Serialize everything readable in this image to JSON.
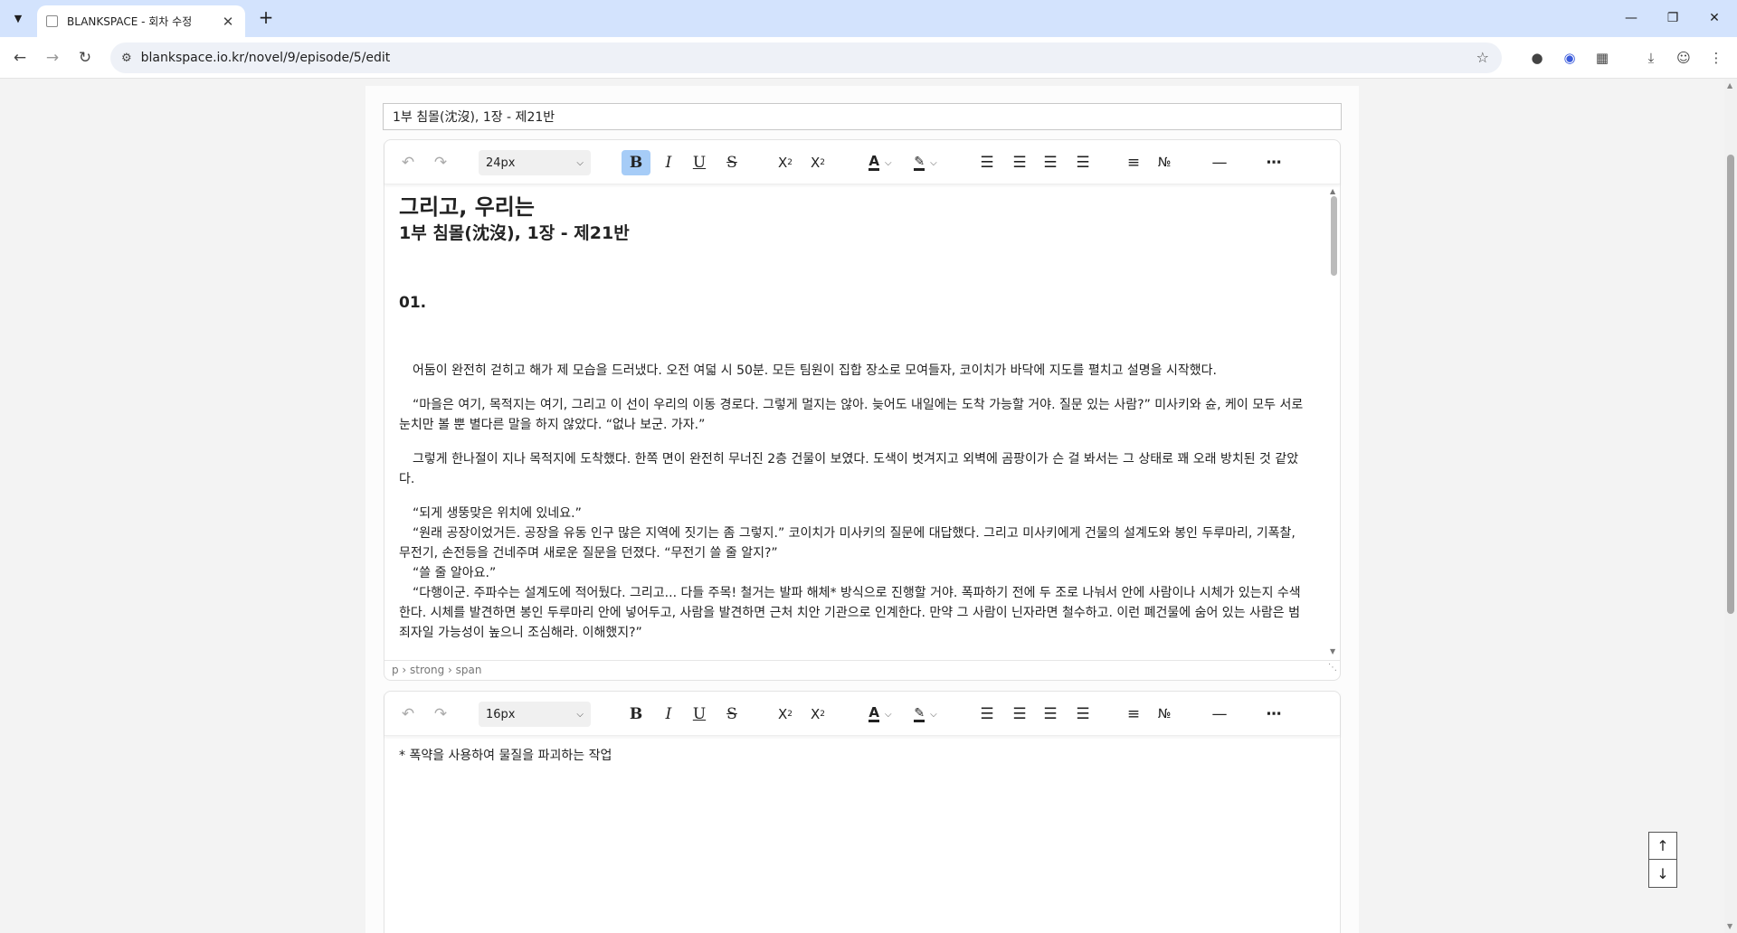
{
  "browser": {
    "tab_title": "BLANKSPACE - 회차 수정",
    "url": "blankspace.io.kr/novel/9/episode/5/edit"
  },
  "form": {
    "title_value": "1부 침몰(沈沒), 1장 - 제21반"
  },
  "main_editor": {
    "font_size": "24px",
    "heading_title": "그리고, 우리는",
    "heading_sub": "1부 침몰(沈沒), 1장 - 제21반",
    "section_number": "01.",
    "paragraphs": [
      "어둠이 완전히 걷히고 해가 제 모습을 드러냈다. 오전 여덟 시 50분. 모든 팀원이 집합 장소로 모여들자, 코이치가 바닥에 지도를 펼치고 설명을 시작했다.",
      "“마을은 여기, 목적지는 여기, 그리고 이 선이 우리의 이동 경로다. 그렇게 멀지는 않아. 늦어도 내일에는 도착 가능할 거야. 질문 있는 사람?” 미사키와 슌, 케이 모두 서로 눈치만 볼 뿐 별다른 말을 하지 않았다. “없나 보군. 가자.”",
      "그렇게 한나절이 지나 목적지에 도착했다. 한쪽 면이 완전히 무너진 2층 건물이 보였다. 도색이 벗겨지고 외벽에 곰팡이가 슨 걸 봐서는 그 상태로 꽤 오래 방치된 것 같았다.",
      "“되게 생뚱맞은 위치에 있네요.”",
      "“원래 공장이었거든. 공장을 유동 인구 많은 지역에 짓기는 좀 그렇지.” 코이치가 미사키의 질문에 대답했다. 그리고 미사키에게 건물의 설계도와 봉인 두루마리, 기폭찰, 무전기, 손전등을 건네주며 새로운 질문을 던졌다. “무전기 쓸 줄 알지?”",
      "“쓸 줄 알아요.”",
      "“다행이군. 주파수는 설계도에 적어뒀다. 그리고... 다들 주목! 철거는 발파 해체* 방식으로 진행할 거야. 폭파하기 전에 두 조로 나눠서 안에 사람이나 시체가 있는지 수색한다. 시체를 발견하면 봉인 두루마리 안에 넣어두고, 사람을 발견하면 근처 치안 기관으로 인계한다. 만약 그 사람이 닌자라면 철수하고. 이런 폐건물에 숨어 있는 사람은 범죄자일 가능성이 높으니 조심해라. 이해했지?”"
    ],
    "status_path": "p › strong › span"
  },
  "footnote_editor": {
    "font_size": "16px",
    "text": "* 폭약을 사용하여 물질을 파괴하는 작업"
  }
}
